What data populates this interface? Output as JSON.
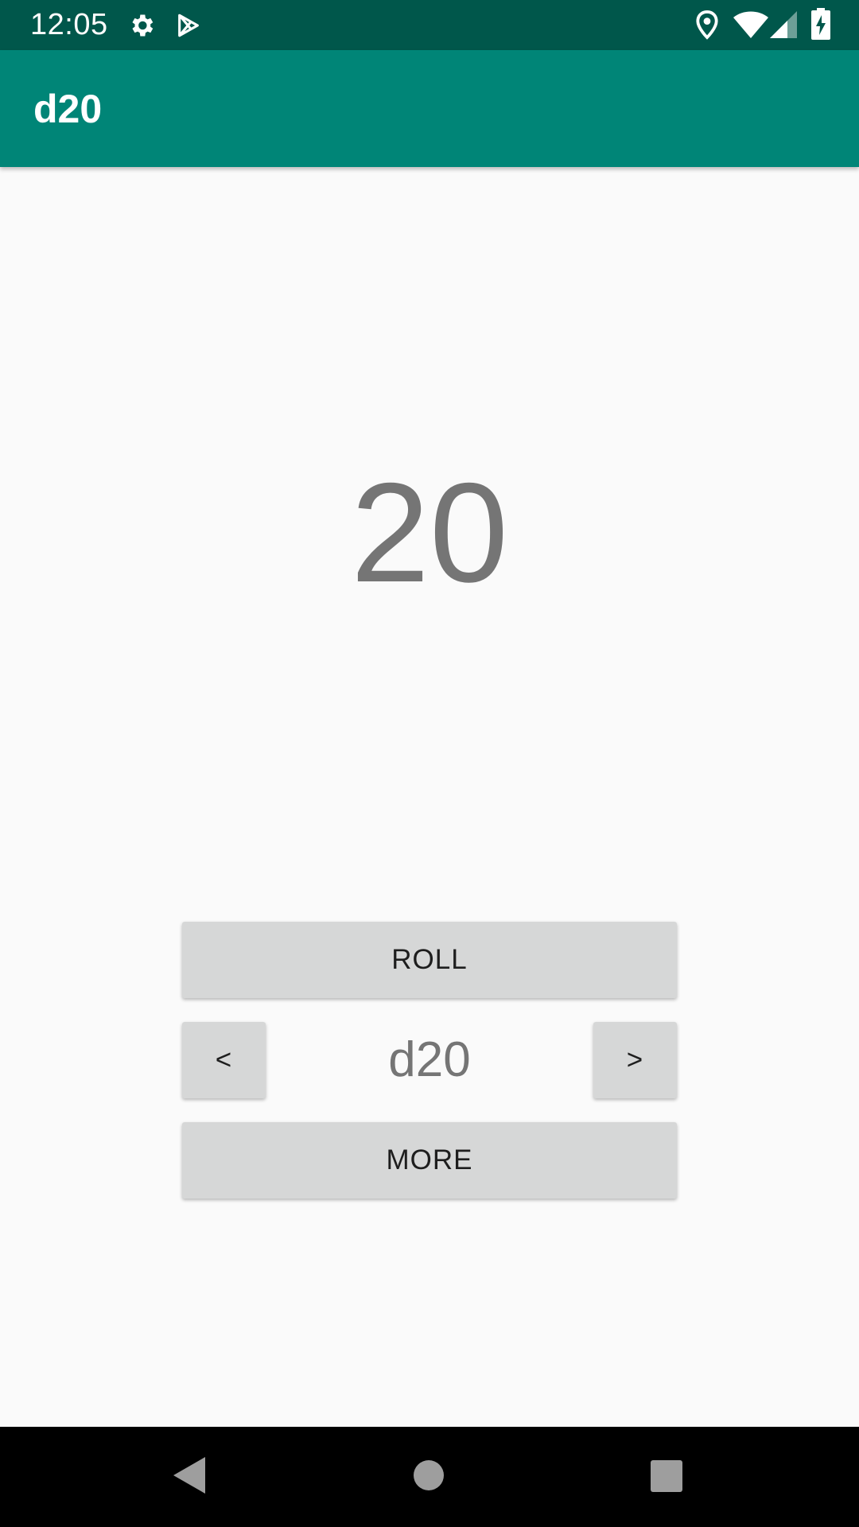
{
  "status_bar": {
    "time": "12:05",
    "icons": [
      "gear-icon",
      "play-store-icon",
      "location-icon",
      "wifi-icon",
      "signal-icon",
      "battery-charging-icon"
    ],
    "color": "#00574b"
  },
  "app_bar": {
    "title": "d20",
    "color": "#008577"
  },
  "main": {
    "result": "20",
    "roll_label": "ROLL",
    "prev_label": "<",
    "die_label": "d20",
    "next_label": ">",
    "more_label": "MORE"
  },
  "nav_bar": {
    "icons": [
      "back-icon",
      "home-icon",
      "recents-icon"
    ]
  }
}
